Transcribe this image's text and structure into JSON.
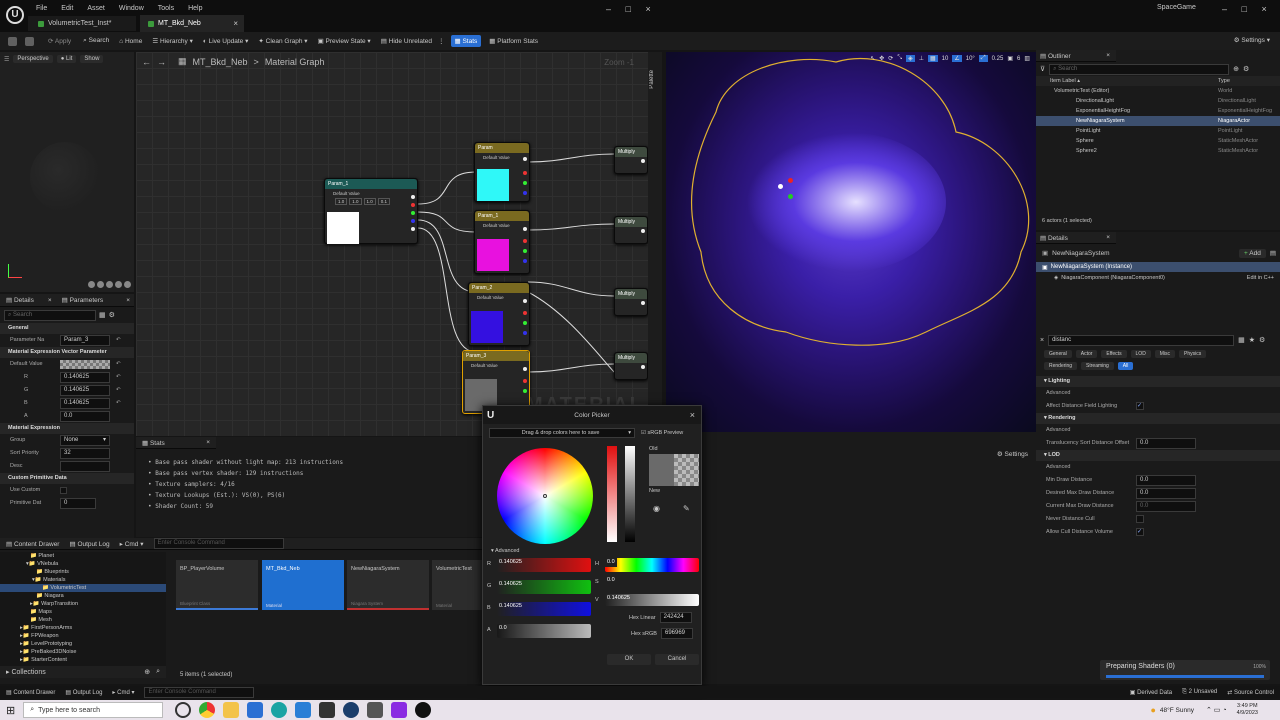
{
  "title_bar": {
    "menus": [
      "File",
      "Edit",
      "Asset",
      "Window",
      "Tools",
      "Help"
    ],
    "tabs": [
      "VolumetricTest_Inst*",
      "MT_Bkd_Neb"
    ],
    "project": "SpaceGame"
  },
  "toolbar": {
    "items": [
      "Apply",
      "Search",
      "Home",
      "Hierarchy",
      "Live Update",
      "Clean Graph",
      "Preview State",
      "Hide Unrelated",
      "Stats",
      "Platform Stats"
    ],
    "settings_label": "Settings"
  },
  "viewport_small": {
    "buttons": [
      "Perspective",
      "Lit",
      "Show"
    ]
  },
  "graph": {
    "breadcrumb_asset": "MT_Bkd_Neb",
    "breadcrumb_sep": ">",
    "breadcrumb_graph": "Material Graph",
    "zoom": "Zoom -1",
    "palette": "Palette",
    "watermark": "MATERIAL",
    "nodes": [
      {
        "title": "Param_1",
        "default": "Default Value",
        "vals": [
          "1.0",
          "1.0",
          "1.0",
          "0.1"
        ]
      },
      {
        "title": "Param",
        "default": "Default Value"
      },
      {
        "title": "Param_1",
        "default": "Default Value"
      },
      {
        "title": "Param_2",
        "default": "Default Value"
      },
      {
        "title": "Param_3",
        "default": "Default Value"
      },
      {
        "title": "Multiply"
      },
      {
        "title": "Multiply"
      },
      {
        "title": "Multiply"
      },
      {
        "title": "Multiply"
      }
    ]
  },
  "details_panel": {
    "tabs": [
      "Details",
      "Parameters"
    ],
    "search": "Search",
    "sections": {
      "general": "General",
      "param_name_label": "Parameter Na",
      "param_name_value": "Param_3",
      "vector_param": "Material Expression Vector Parameter",
      "default_value_label": "Default Value",
      "r_label": "R",
      "r_value": "0.140625",
      "g_label": "G",
      "g_value": "0.140625",
      "b_label": "B",
      "b_value": "0.140625",
      "a_label": "A",
      "a_value": "0.0",
      "material_expression": "Material Expression",
      "group_label": "Group",
      "group_value": "None",
      "sort_label": "Sort Priority",
      "sort_value": "32",
      "desc_label": "Desc",
      "custom_prim": "Custom Primitive Data",
      "use_custom_label": "Use Custom",
      "prim_index_label": "Primitive Dat",
      "prim_index_value": "0"
    }
  },
  "stats": {
    "tab": "Stats",
    "lines": [
      "Base pass shader without light map: 213 instructions",
      "Base pass vertex shader: 129 instructions",
      "Texture samplers: 4/16",
      "Texture Lookups (Est.): VS(0), PS(6)",
      "Shader Count: 59"
    ]
  },
  "content": {
    "tabs": [
      "Content Drawer",
      "Output Log",
      "Cmd"
    ],
    "cmd_placeholder": "Enter Console Command",
    "tree": [
      "Planet",
      "VNebula",
      "Blueprints",
      "Materials",
      "VolumetricTest",
      "Niagara",
      "WarpTransition",
      "Maps",
      "Mesh",
      "FirstPersonArms",
      "FPWeapon",
      "LevelPrototyping",
      "PreBaked3DNoise",
      "StarterContent"
    ],
    "assets": [
      {
        "name": "BP_PlayerVolume",
        "type": "Blueprint Class"
      },
      {
        "name": "MT_Bkd_Neb",
        "type": "Material"
      },
      {
        "name": "NewNiagaraSystem",
        "type": "Niagara System"
      },
      {
        "name": "VolumetricTest",
        "type": "Material"
      }
    ],
    "collections": "Collections",
    "status": "5 items (1 selected)"
  },
  "color_picker": {
    "title": "Color Picker",
    "dropdown": "Drag & drop colors here to save",
    "srgb": "sRGB Preview",
    "old": "Old",
    "new": "New",
    "advanced": "Advanced",
    "r_label": "R",
    "r": "0.140625",
    "g_label": "G",
    "g": "0.140625",
    "b_label": "B",
    "b": "0.140625",
    "a_label": "A",
    "a": "0.0",
    "h_label": "H",
    "h": "0.0",
    "s_label": "S",
    "s": "0.0",
    "v_label": "V",
    "v": "0.140625",
    "hex_linear_label": "Hex Linear",
    "hex_linear": "242424",
    "hex_srgb_label": "Hex sRGB",
    "hex_srgb": "696969",
    "ok": "OK",
    "cancel": "Cancel"
  },
  "level_viewport": {
    "stats": [
      "10",
      "10°",
      "0.25",
      "6"
    ],
    "settings": "Settings"
  },
  "outliner": {
    "tab": "Outliner",
    "search": "Search",
    "col_label": "Item Label",
    "col_type": "Type",
    "rows": [
      {
        "label": "VolumetricTest (Editor)",
        "type": "World"
      },
      {
        "label": "DirectionalLight",
        "type": "DirectionalLight"
      },
      {
        "label": "ExponentialHeightFog",
        "type": "ExponentialHeightFog"
      },
      {
        "label": "NewNiagaraSystem",
        "type": "NiagaraActor"
      },
      {
        "label": "PointLight",
        "type": "PointLight"
      },
      {
        "label": "Sphere",
        "type": "StaticMeshActor"
      },
      {
        "label": "Sphere2",
        "type": "StaticMeshActor"
      }
    ],
    "count": "6 actors (1 selected)"
  },
  "details": {
    "tab": "Details",
    "actor": "NewNiagaraSystem",
    "add": "Add",
    "instance": "NewNiagaraSystem (Instance)",
    "component": "NiagaraComponent (NiagaraComponent0)",
    "edit_cpp": "Edit in C++",
    "search": "distanc",
    "filters": [
      "General",
      "Actor",
      "Effects",
      "LOD",
      "Misc",
      "Physics",
      "Rendering",
      "Streaming",
      "All"
    ],
    "lighting": "Lighting",
    "advanced": "Advanced",
    "affect_df": "Affect Distance Field Lighting",
    "rendering": "Rendering",
    "translucency": "Translucency Sort Distance Offset",
    "translucency_val": "0.0",
    "lod": "LOD",
    "min_draw": "Min Draw Distance",
    "min_draw_val": "0.0",
    "desired_max": "Desired Max Draw Distance",
    "desired_max_val": "0.0",
    "current_max": "Current Max Draw Distance",
    "current_max_val": "0.0",
    "never_cull": "Never Distance Cull",
    "allow_cull": "Allow Cull Distance Volume"
  },
  "shaders": {
    "label": "Preparing Shaders (0)",
    "pct": "100%",
    "progress": 1.0
  },
  "status_bar": {
    "tabs": [
      "Content Drawer",
      "Output Log",
      "Cmd"
    ],
    "cmd_placeholder": "Enter Console Command",
    "derived": "Derived Data",
    "unsaved": "2 Unsaved",
    "source": "Source Control"
  },
  "taskbar": {
    "search": "Type here to search",
    "weather": "48°F Sunny",
    "time": "3:49 PM",
    "date": "4/9/2023"
  }
}
